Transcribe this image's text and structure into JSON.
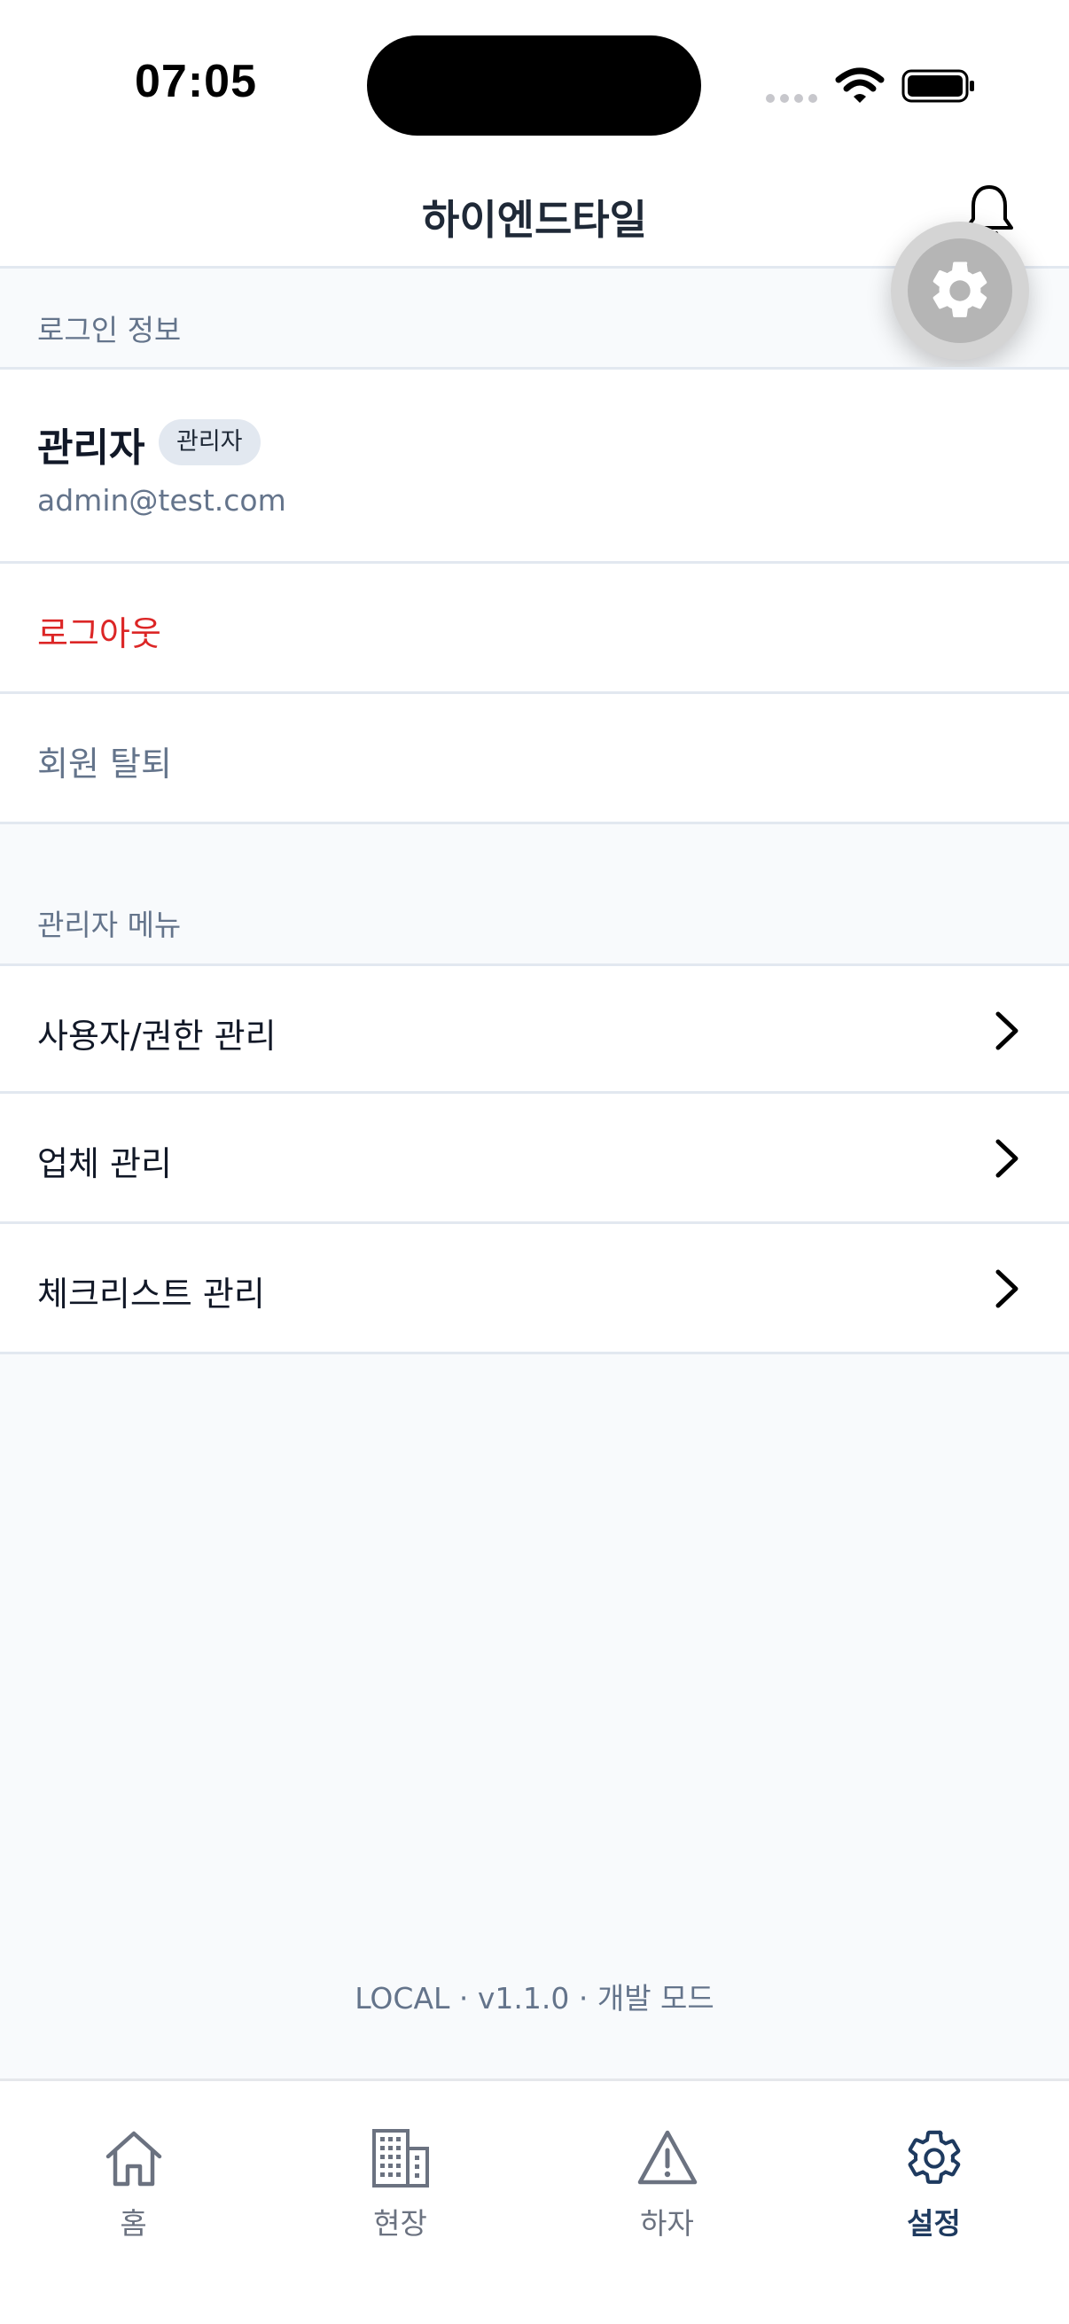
{
  "status_bar": {
    "time": "07:05"
  },
  "header": {
    "title": "하이엔드타일"
  },
  "login_section": {
    "label": "로그인 정보",
    "user_name": "관리자",
    "role_badge": "관리자",
    "email": "admin@test.com",
    "logout_label": "로그아웃",
    "withdraw_label": "회원 탈퇴"
  },
  "admin_section": {
    "label": "관리자 메뉴",
    "items": [
      {
        "label": "사용자/권한 관리"
      },
      {
        "label": "업체 관리"
      },
      {
        "label": "체크리스트 관리"
      }
    ]
  },
  "footer": {
    "version_text": "LOCAL · v1.1.0 · 개발 모드"
  },
  "tabbar": {
    "tabs": [
      {
        "label": "홈",
        "icon": "home-icon",
        "active": false
      },
      {
        "label": "현장",
        "icon": "building-icon",
        "active": false
      },
      {
        "label": "하자",
        "icon": "warning-icon",
        "active": false
      },
      {
        "label": "설정",
        "icon": "gear-icon",
        "active": true
      }
    ]
  },
  "colors": {
    "background": "#F8FAFC",
    "danger": "#DC2626",
    "muted": "#64748B",
    "active_tab": "#1E3A5F",
    "divider": "#E2E8F0"
  }
}
